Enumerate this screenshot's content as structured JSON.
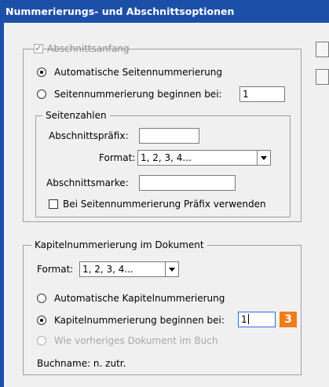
{
  "window": {
    "title": "Nummerierungs- und Abschnittsoptionen"
  },
  "section_start": {
    "label": "Abschnittsanfang",
    "checked": true,
    "auto_numbering_label": "Automatische Seitennummerierung",
    "start_at_label": "Seitennummerierung beginnen bei:",
    "start_at_value": "1"
  },
  "page_numbers": {
    "legend": "Seitenzahlen",
    "prefix_label": "Abschnittspräfix:",
    "prefix_value": "",
    "format_label": "Format:",
    "format_value": "1, 2, 3, 4...",
    "marker_label": "Abschnittsmarke:",
    "marker_value": "",
    "include_prefix_label": "Bei Seitennummerierung Präfix verwenden"
  },
  "chapter": {
    "legend": "Kapitelnummerierung im Dokument",
    "format_label": "Format:",
    "format_value": "1, 2, 3, 4...",
    "auto_label": "Automatische Kapitelnummerierung",
    "start_at_label": "Kapitelnummerierung beginnen bei:",
    "start_at_value": "1",
    "badge": "3",
    "same_as_previous_label": "Wie vorheriges Dokument im Buch",
    "book_name_text": "Buchname: n. zutr."
  },
  "colors": {
    "titlebar": "#1c4fa8",
    "badge": "#f07c18",
    "focus": "#2a6fd6"
  }
}
